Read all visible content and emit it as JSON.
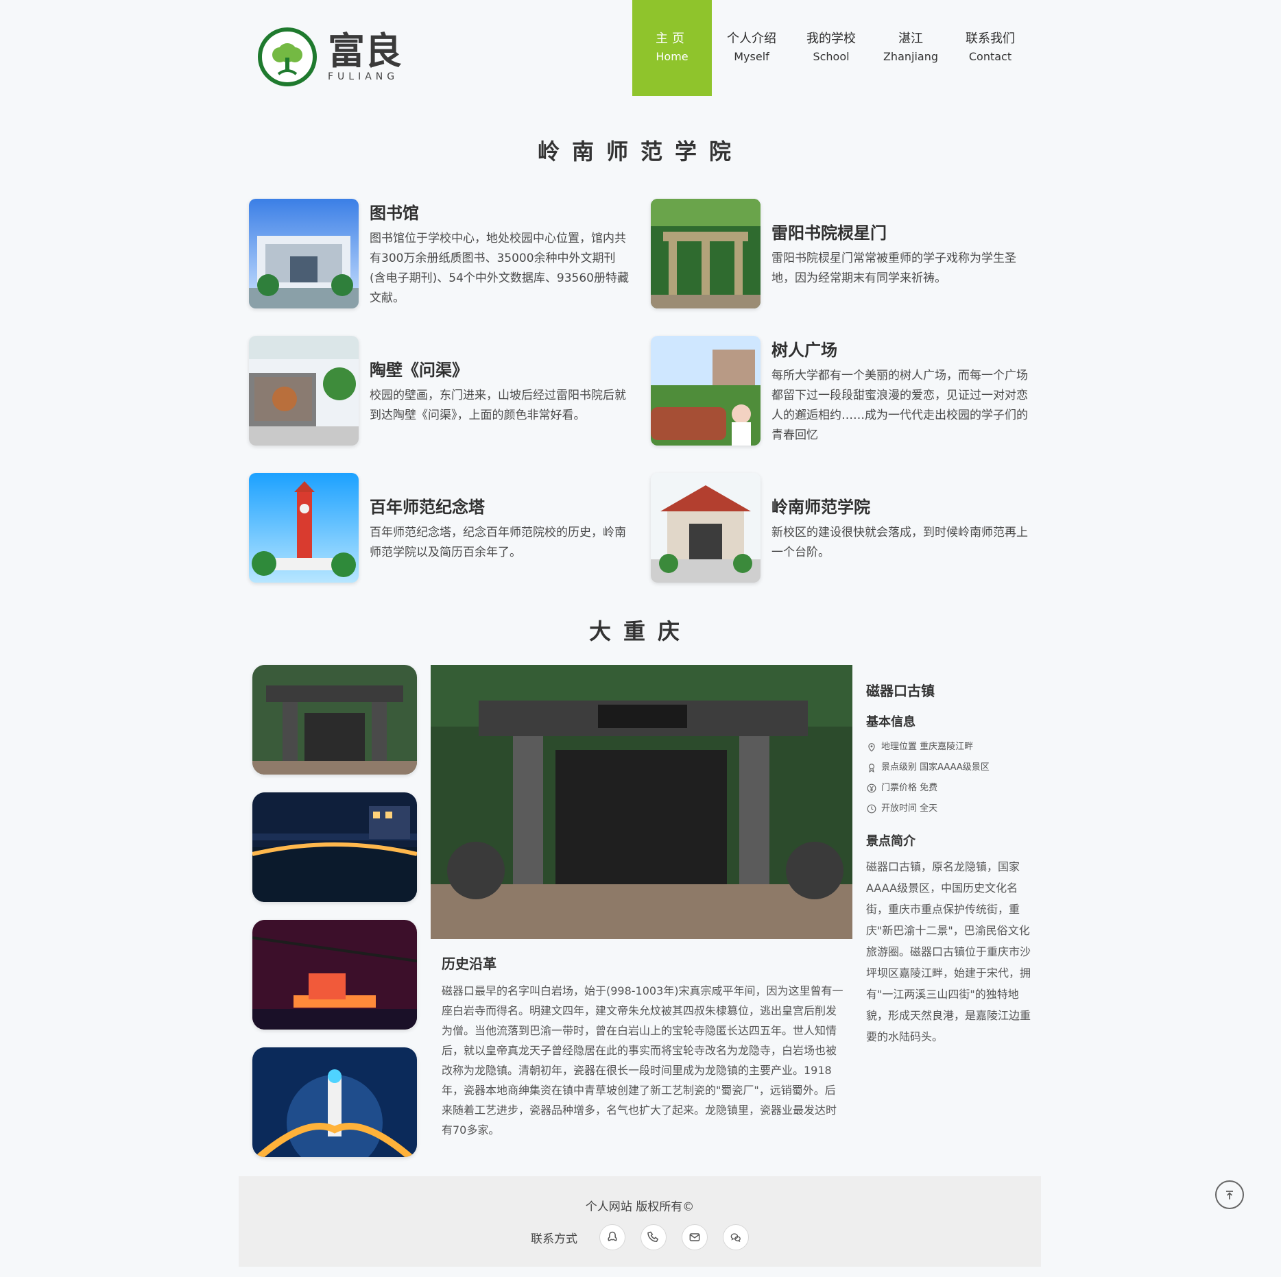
{
  "brand": {
    "cn": "富良",
    "en": "FULIANG",
    "icon": "tree-logo-icon",
    "colors": {
      "ring": "#1f7a2e",
      "tree": "#74b943"
    }
  },
  "nav": {
    "items": [
      {
        "cn": "主页",
        "en": "Home",
        "active": true
      },
      {
        "cn": "个人介绍",
        "en": "Myself",
        "active": false
      },
      {
        "cn": "我的学校",
        "en": "School",
        "active": false
      },
      {
        "cn": "湛江",
        "en": "Zhanjiang",
        "active": false
      },
      {
        "cn": "联系我们",
        "en": "Contact",
        "active": false
      }
    ],
    "accent": "#8fc42c"
  },
  "sections": {
    "school_title": "岭南师范学院",
    "city_title": "大重庆"
  },
  "campus": [
    {
      "title": "图书馆",
      "desc": "图书馆位于学校中心，地处校园中心位置，馆内共有300万余册纸质图书、35000余种中外文期刊(含电子期刊)、54个中外文数据库、93560册特藏文献。",
      "image": "library-photo"
    },
    {
      "title": "雷阳书院棂星门",
      "desc": "雷阳书院棂星门常常被重师的学子戏称为学生圣地，因为经常期末有同学来祈祷。",
      "image": "gate-photo"
    },
    {
      "title": "陶壁《问渠》",
      "desc": "校园的壁画，东门进来，山坡后经过雷阳书院后就到达陶壁《问渠》，上面的颜色非常好看。",
      "image": "mural-photo"
    },
    {
      "title": "树人广场",
      "desc": "每所大学都有一个美丽的树人广场，而每一个广场都留下过一段段甜蜜浪漫的爱恋，见证过一对对恋人的邂逅相约……成为一代代走出校园的学子们的青春回忆",
      "image": "square-photo"
    },
    {
      "title": "百年师范纪念塔",
      "desc": "百年师范纪念塔，纪念百年师范院校的历史，岭南师范学院以及简历百余年了。",
      "image": "tower-photo"
    },
    {
      "title": "岭南师范学院",
      "desc": "新校区的建设很快就会落成，到时候岭南师范再上一个台阶。",
      "image": "campus-gate-photo"
    }
  ],
  "chongqing": {
    "thumbs": [
      "ciqikou-thumb",
      "bridge-night-thumb",
      "cable-car-thumb",
      "jiefangbei-thumb"
    ],
    "main_image": "ciqikou-main-photo",
    "history_title": "历史沿革",
    "history_text": "磁器口最早的名字叫白岩场，始于(998-1003年)宋真宗咸平年间，因为这里曾有一座白岩寺而得名。明建文四年，建文帝朱允炆被其四叔朱棣篡位，逃出皇宫后削发为僧。当他流落到巴渝一带时，曾在白岩山上的宝轮寺隐匿长达四五年。世人知情后，就以皇帝真龙天子曾经隐居在此的事实而将宝轮寺改名为龙隐寺，白岩场也被改称为龙隐镇。清朝初年，瓷器在很长一段时间里成为龙隐镇的主要产业。1918年，瓷器本地商绅集资在镇中青草坡创建了新工艺制瓷的\"蜀瓷厂\"，远销蜀外。后来随着工艺进步，瓷器品种增多，名气也扩大了起来。龙隐镇里，瓷器业最发达时有70多家。",
    "info": {
      "title": "磁器口古镇",
      "basic_title": "基本信息",
      "rows": [
        {
          "icon": "location-icon",
          "text": "地理位置 重庆嘉陵江畔"
        },
        {
          "icon": "award-icon",
          "text": "景点级别 国家AAAA级景区"
        },
        {
          "icon": "yen-icon",
          "text": "门票价格 免费"
        },
        {
          "icon": "clock-icon",
          "text": "开放时间 全天"
        }
      ],
      "intro_title": "景点简介",
      "intro_text": "磁器口古镇，原名龙隐镇，国家AAAA级景区，中国历史文化名街，重庆市重点保护传统街，重庆\"新巴渝十二景\"，巴渝民俗文化旅游圈。磁器口古镇位于重庆市沙坪坝区嘉陵江畔，始建于宋代，拥有\"一江两溪三山四街\"的独特地貌，形成天然良港，是嘉陵江边重要的水陆码头。"
    }
  },
  "footer": {
    "copyright": "个人网站 版权所有©",
    "contact_label": "联系方式",
    "icons": [
      "qq-icon",
      "phone-icon",
      "mail-icon",
      "wechat-icon"
    ]
  },
  "backtop": {
    "icon": "back-to-top-icon"
  }
}
